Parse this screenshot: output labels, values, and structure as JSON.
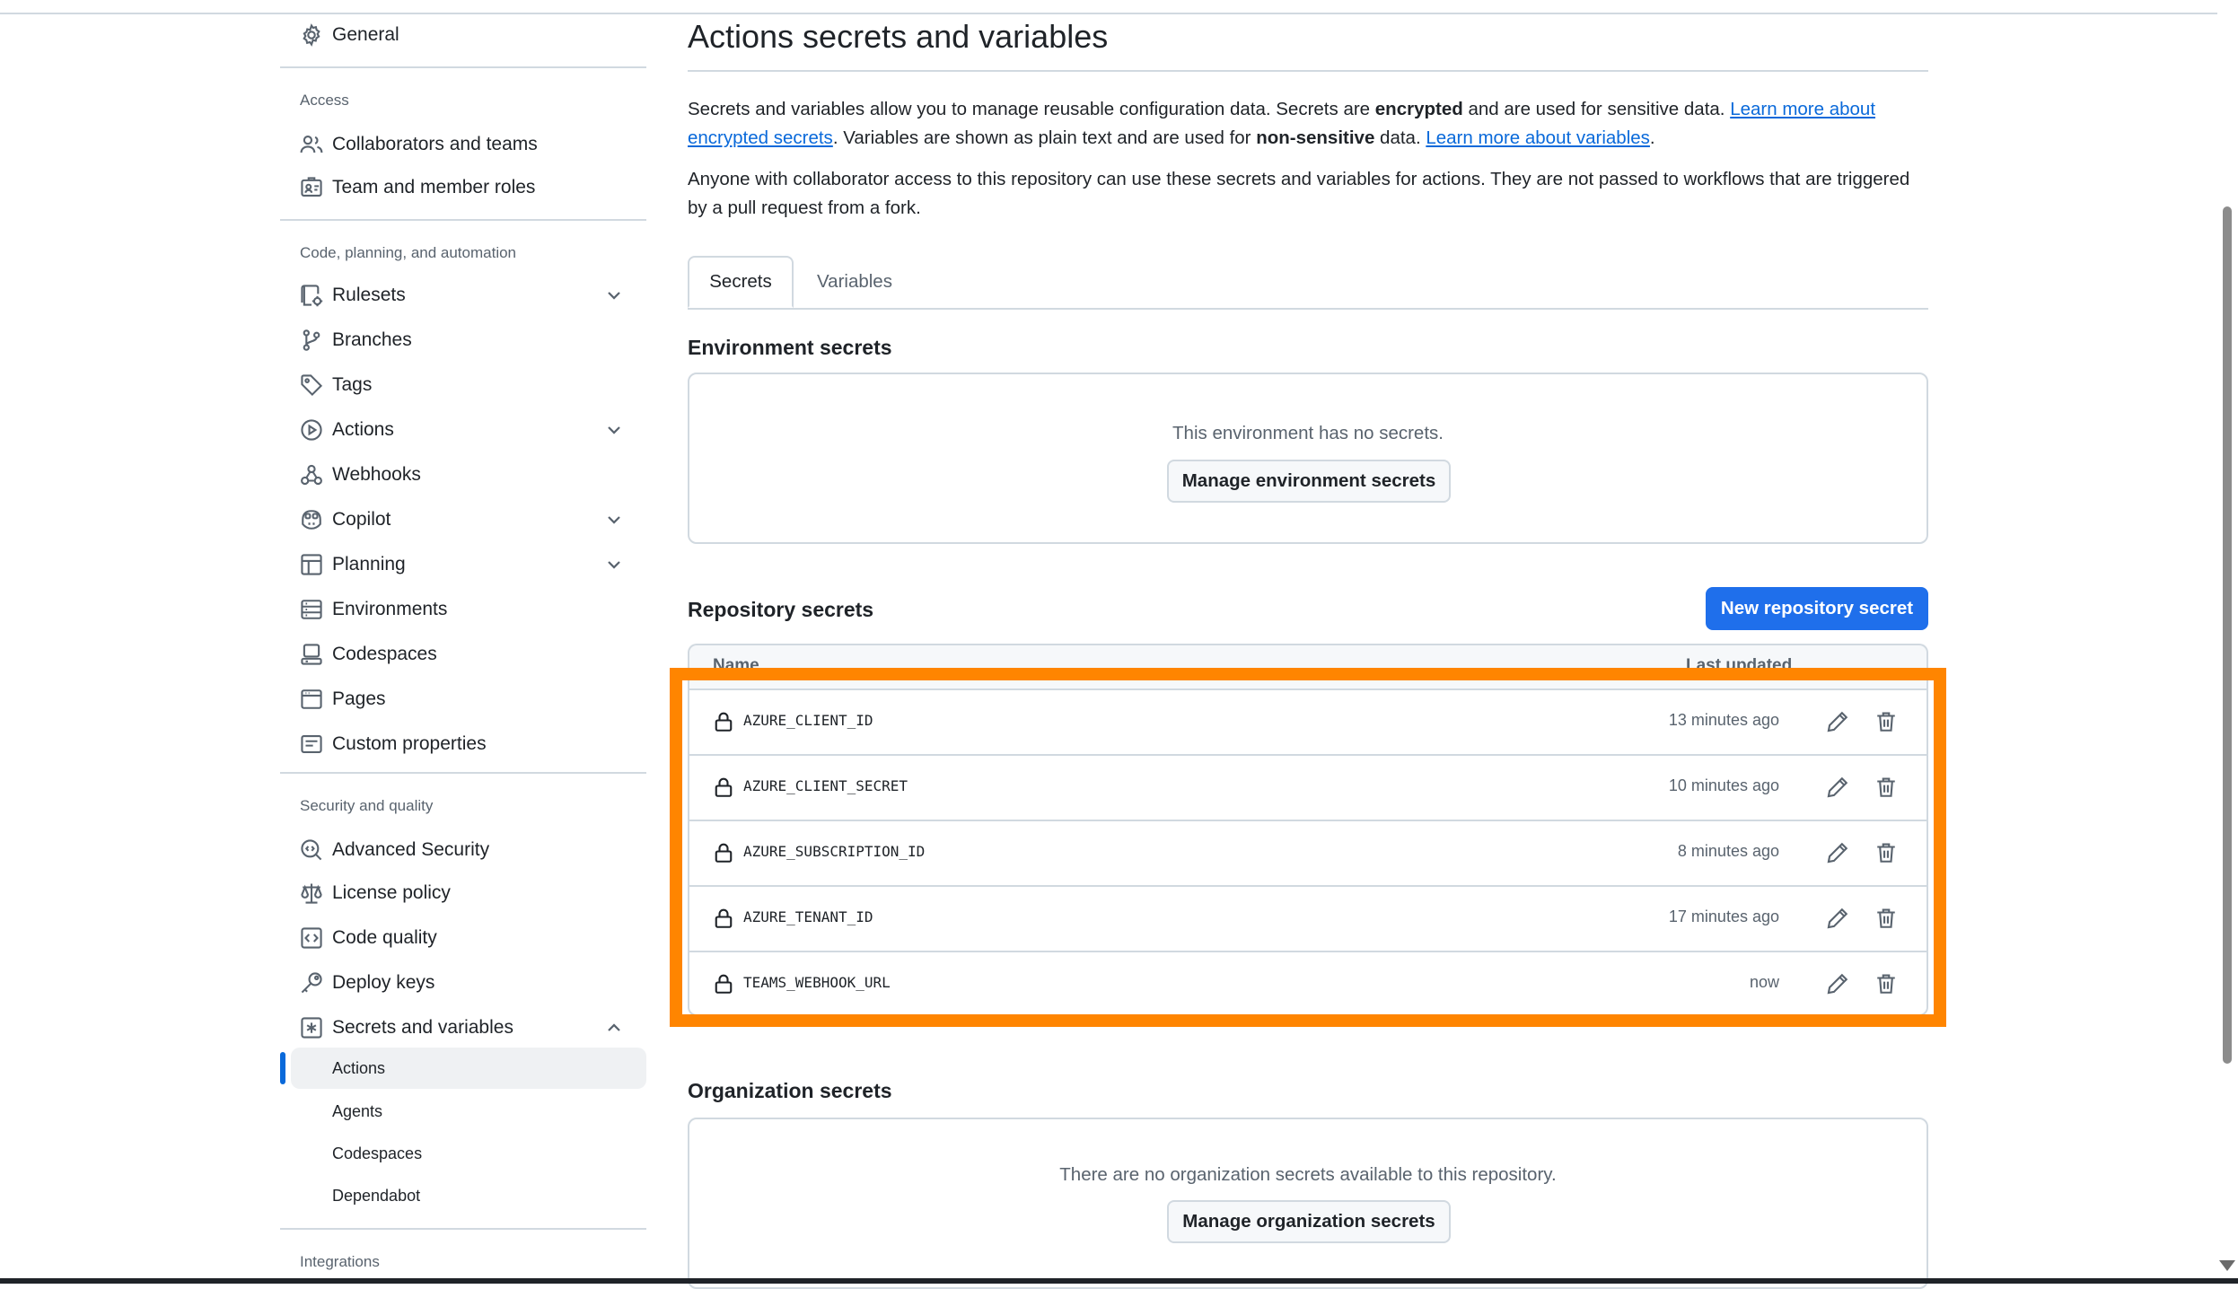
{
  "sidebar": {
    "general": "General",
    "access_title": "Access",
    "collaborators": "Collaborators and teams",
    "team_roles": "Team and member roles",
    "code_title": "Code, planning, and automation",
    "rulesets": "Rulesets",
    "branches": "Branches",
    "tags": "Tags",
    "actions": "Actions",
    "webhooks": "Webhooks",
    "copilot": "Copilot",
    "planning": "Planning",
    "environments": "Environments",
    "codespaces": "Codespaces",
    "pages": "Pages",
    "custom_properties": "Custom properties",
    "security_title": "Security and quality",
    "advanced_security": "Advanced Security",
    "license_policy": "License policy",
    "code_quality": "Code quality",
    "deploy_keys": "Deploy keys",
    "secrets_variables": "Secrets and variables",
    "sub_actions": "Actions",
    "sub_agents": "Agents",
    "sub_codespaces": "Codespaces",
    "sub_dependabot": "Dependabot",
    "integrations_title": "Integrations"
  },
  "main": {
    "title": "Actions secrets and variables",
    "intro": {
      "p1_a": "Secrets and variables allow you to manage reusable configuration data. Secrets are ",
      "p1_b": "encrypted",
      "p1_c": " and are used for sensitive data. ",
      "p1_link1": "Learn more about encrypted secrets",
      "p1_d": ". Variables are shown as plain text and are used for ",
      "p1_e": "non-sensitive",
      "p1_f": " data. ",
      "p1_link2": "Learn more about variables",
      "p1_g": ".",
      "p2": "Anyone with collaborator access to this repository can use these secrets and variables for actions. They are not passed to workflows that are triggered by a pull request from a fork."
    },
    "tabs": [
      "Secrets",
      "Variables"
    ],
    "env_secrets": {
      "title": "Environment secrets",
      "empty": "This environment has no secrets.",
      "button": "Manage environment secrets"
    },
    "repo_secrets": {
      "title": "Repository secrets",
      "new_button": "New repository secret",
      "col_name": "Name",
      "col_updated": "Last updated",
      "rows": [
        {
          "name": "AZURE_CLIENT_ID",
          "updated": "13 minutes ago"
        },
        {
          "name": "AZURE_CLIENT_SECRET",
          "updated": "10 minutes ago"
        },
        {
          "name": "AZURE_SUBSCRIPTION_ID",
          "updated": "8 minutes ago"
        },
        {
          "name": "AZURE_TENANT_ID",
          "updated": "17 minutes ago"
        },
        {
          "name": "TEAMS_WEBHOOK_URL",
          "updated": "now"
        }
      ]
    },
    "org_secrets": {
      "title": "Organization secrets",
      "empty": "There are no organization secrets available to this repository.",
      "button": "Manage organization secrets"
    }
  },
  "colors": {
    "accent": "#0969da",
    "primary_button": "#1f6feb",
    "highlight": "#ff8500",
    "border": "#d1d9e0"
  }
}
